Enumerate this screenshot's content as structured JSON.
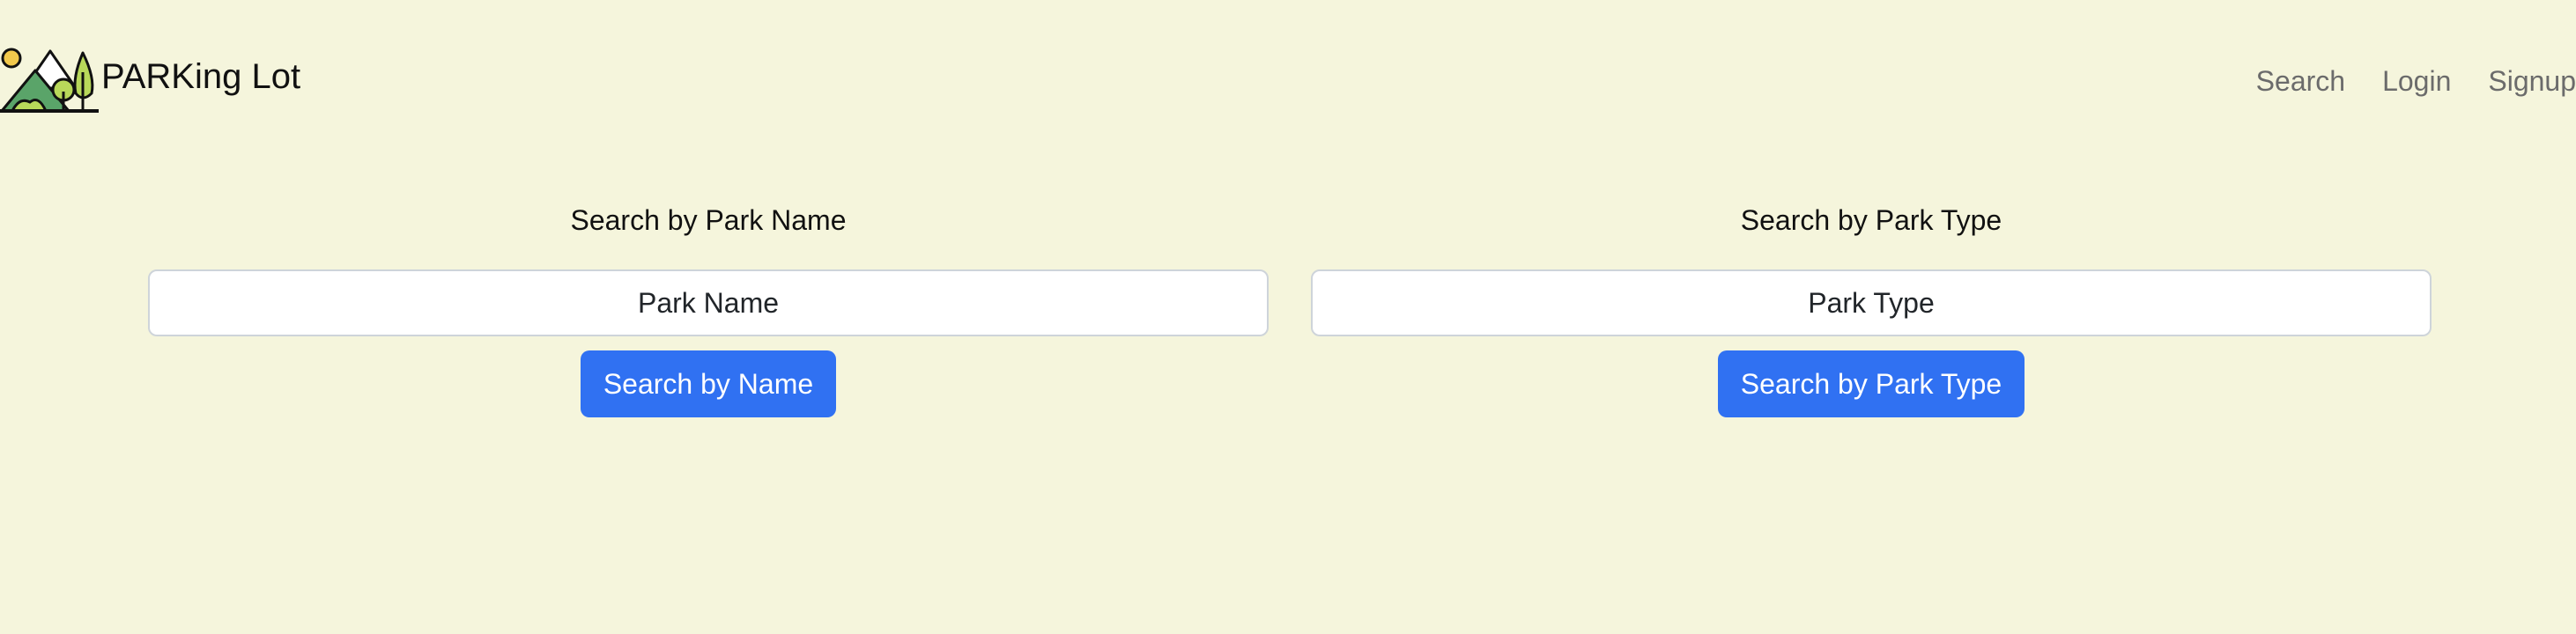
{
  "brand": {
    "name": "PARKing Lot",
    "logo_icon": "park-mountains-trees-logo-icon"
  },
  "nav": {
    "items": [
      {
        "label": "Search"
      },
      {
        "label": "Login"
      },
      {
        "label": "Signup"
      }
    ]
  },
  "search_by_name": {
    "title": "Search by Park Name",
    "placeholder": "Park Name",
    "value": "",
    "button_label": "Search by Name"
  },
  "search_by_type": {
    "title": "Search by Park Type",
    "placeholder": "Park Type",
    "value": "",
    "button_label": "Search by Park Type"
  },
  "colors": {
    "page_background": "#f5f5dc",
    "primary_button": "#3071f2",
    "nav_link": "#6b6b6b",
    "input_border": "#ced4da"
  }
}
